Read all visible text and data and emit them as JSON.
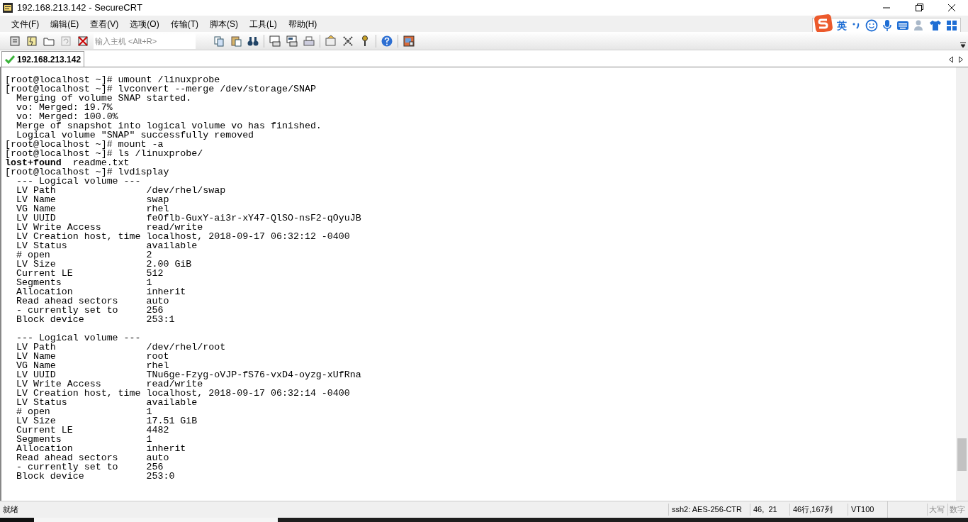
{
  "window": {
    "title": "192.168.213.142 - SecureCRT"
  },
  "menu": [
    "文件(F)",
    "编辑(E)",
    "查看(V)",
    "选项(O)",
    "传输(T)",
    "脚本(S)",
    "工具(L)",
    "帮助(H)"
  ],
  "toolbar": {
    "host_field": {
      "placeholder": "输入主机 <Alt+R>"
    }
  },
  "ime_bar": {
    "language": "英"
  },
  "tabs": [
    {
      "label": "192.168.213.142",
      "selected": true
    }
  ],
  "terminal": {
    "blocks": [
      [
        "[root@localhost ~]# umount /linuxprobe",
        "[root@localhost ~]# lvconvert --merge /dev/storage/SNAP",
        "  Merging of volume SNAP started.",
        "  vo: Merged: 19.7%",
        "  vo: Merged: 100.0%",
        "  Merge of snapshot into logical volume vo has finished.",
        "  Logical volume \"SNAP\" successfully removed",
        "[root@localhost ~]# mount -a",
        "[root@localhost ~]# ls /linuxprobe/",
        "**lost+found**  readme.txt",
        "[root@localhost ~]# lvdisplay",
        "  --- Logical volume ---",
        "  LV Path                /dev/rhel/swap",
        "  LV Name                swap",
        "  VG Name                rhel",
        "  LV UUID                feOflb-GuxY-ai3r-xY47-QlSO-nsF2-qOyuJB",
        "  LV Write Access        read/write",
        "  LV Creation host, time localhost, 2018-09-17 06:32:12 -0400",
        "  LV Status              available",
        "  # open                 2",
        "  LV Size                2.00 GiB",
        "  Current LE             512",
        "  Segments               1",
        "  Allocation             inherit",
        "  Read ahead sectors     auto",
        "  - currently set to     256",
        "  Block device           253:1"
      ],
      [
        "  --- Logical volume ---",
        "  LV Path                /dev/rhel/root",
        "  LV Name                root",
        "  VG Name                rhel",
        "  LV UUID                TNu6ge-Fzyg-oVJP-fS76-vxD4-oyzg-xUfRna",
        "  LV Write Access        read/write",
        "  LV Creation host, time localhost, 2018-09-17 06:32:14 -0400",
        "  LV Status              available",
        "  # open                 1",
        "  LV Size                17.51 GiB",
        "  Current LE             4482",
        "  Segments               1",
        "  Allocation             inherit",
        "  Read ahead sectors     auto",
        "  - currently set to     256",
        "  Block device           253:0"
      ]
    ]
  },
  "status_bar": {
    "message": "就绪",
    "cipher": "ssh2: AES-256-CTR",
    "cursor": "46,  21",
    "size": "46行,167列",
    "terminal_type": "VT100",
    "caps": "大写",
    "num": "数字"
  }
}
